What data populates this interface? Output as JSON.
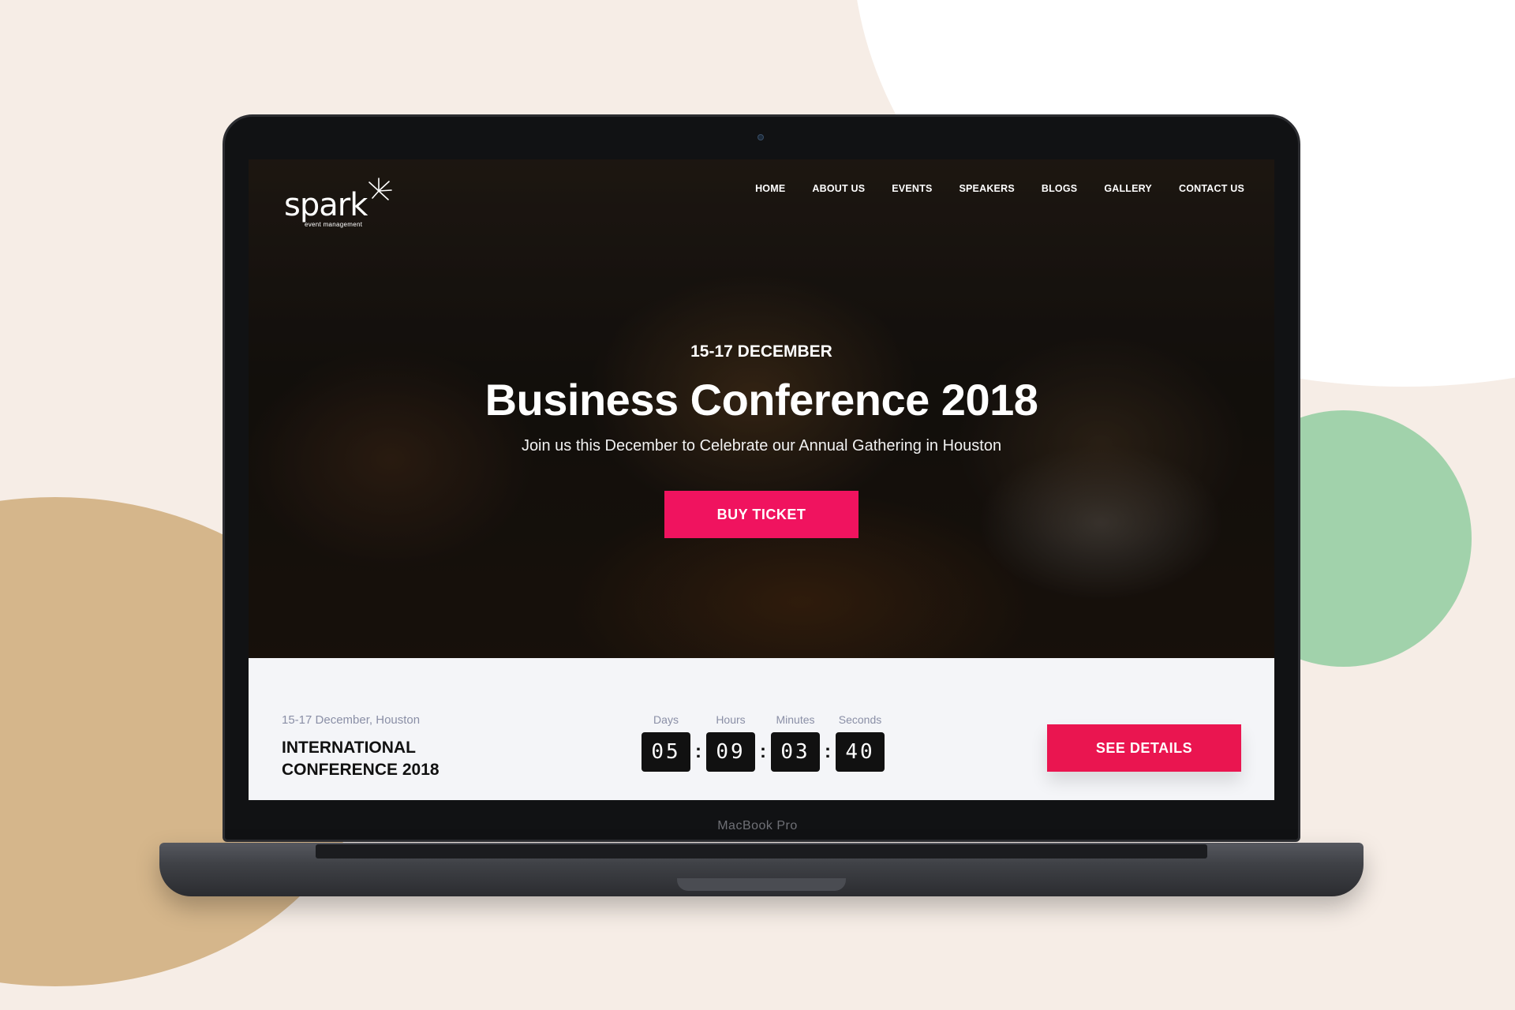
{
  "device": {
    "label": "MacBook Pro"
  },
  "header": {
    "logo": {
      "name": "spark",
      "tagline": "event management"
    },
    "nav": [
      "HOME",
      "ABOUT US",
      "EVENTS",
      "SPEAKERS",
      "BLOGS",
      "GALLERY",
      "CONTACT US"
    ]
  },
  "hero": {
    "date": "15-17 DECEMBER",
    "title": "Business Conference 2018",
    "subtitle": "Join us this December to Celebrate our Annual Gathering in Houston",
    "cta_label": "BUY TICKET"
  },
  "info_bar": {
    "meta": "15-17 December, Houston",
    "event_name": "INTERNATIONAL CONFERENCE 2018",
    "countdown": {
      "days_label": "Days",
      "days": "05",
      "hours_label": "Hours",
      "hours": "09",
      "minutes_label": "Minutes",
      "minutes": "03",
      "seconds_label": "Seconds",
      "seconds": "40",
      "separator": ":"
    },
    "details_label": "SEE DETAILS"
  },
  "colors": {
    "accent": "#f0135f",
    "accent_alt": "#ea1550",
    "background": "#f6ede6",
    "blob_green": "#a1d2ab",
    "blob_tan": "#d5b68b"
  }
}
